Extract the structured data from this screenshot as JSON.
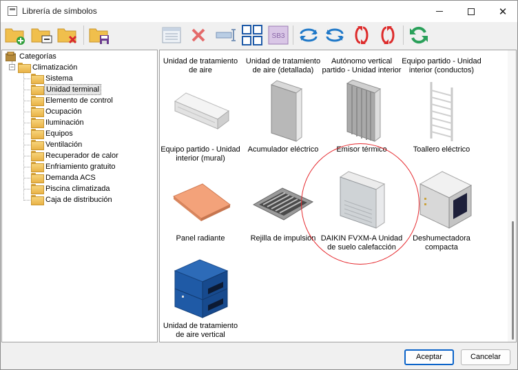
{
  "window": {
    "title": "Librería de símbolos"
  },
  "toolbar": {
    "buttons": [
      {
        "icon": "new-folder-icon"
      },
      {
        "icon": "edit-folder-icon"
      },
      {
        "icon": "delete-folder-icon"
      },
      {
        "icon": "save-folder-icon"
      },
      {
        "icon": "table-view-icon"
      },
      {
        "icon": "delete-icon"
      },
      {
        "icon": "resize-icon"
      },
      {
        "icon": "grid-view-icon"
      },
      {
        "icon": "sb3-file-icon",
        "text": "SB3"
      },
      {
        "icon": "rotate-left-icon"
      },
      {
        "icon": "rotate-right-icon"
      },
      {
        "icon": "flip-vertical-icon"
      },
      {
        "icon": "flip-vertical-alt-icon"
      },
      {
        "icon": "refresh-icon"
      }
    ]
  },
  "tree": {
    "root": "Categorías",
    "group": "Climatización",
    "items": [
      {
        "label": "Sistema"
      },
      {
        "label": "Unidad terminal",
        "selected": true
      },
      {
        "label": "Elemento de control"
      },
      {
        "label": "Ocupación"
      },
      {
        "label": "Iluminación"
      },
      {
        "label": "Equipos"
      },
      {
        "label": "Ventilación"
      },
      {
        "label": "Recuperador de calor"
      },
      {
        "label": "Enfriamiento gratuito"
      },
      {
        "label": "Demanda ACS"
      },
      {
        "label": "Piscina climatizada"
      },
      {
        "label": "Caja de distribución"
      }
    ]
  },
  "symbols": [
    {
      "label": "Unidad de tratamiento de aire",
      "icon": "air-handling-unit-icon"
    },
    {
      "label": "Unidad de tratamiento de aire (detallada)",
      "icon": "air-handling-unit-detailed-icon"
    },
    {
      "label": "Autónomo vertical partido - Unidad interior",
      "icon": "vertical-split-unit-icon"
    },
    {
      "label": "Equipo partido - Unidad interior (conductos)",
      "icon": "ducted-split-unit-icon"
    },
    {
      "label": "Equipo partido - Unidad interior (mural)",
      "icon": "wall-split-unit-icon"
    },
    {
      "label": "Acumulador eléctrico",
      "icon": "storage-heater-icon"
    },
    {
      "label": "Emisor térmico",
      "icon": "thermal-emitter-icon"
    },
    {
      "label": "Toallero eléctrico",
      "icon": "towel-rail-icon"
    },
    {
      "label": "Panel radiante",
      "icon": "radiant-panel-icon"
    },
    {
      "label": "Rejilla de impulsión",
      "icon": "supply-grille-icon"
    },
    {
      "label": "DAIKIN FVXM-A Unidad de suelo calefacción",
      "icon": "floor-heating-unit-icon"
    },
    {
      "label": "Deshumectadora compacta",
      "icon": "dehumidifier-icon"
    },
    {
      "label": "Unidad de tratamiento de aire vertical",
      "icon": "vertical-air-handling-unit-icon"
    }
  ],
  "buttons": {
    "accept": "Aceptar",
    "cancel": "Cancelar"
  },
  "colors": {
    "accent": "#0a63c9",
    "annotation": "#e5262b",
    "folder": "#e9b247"
  }
}
